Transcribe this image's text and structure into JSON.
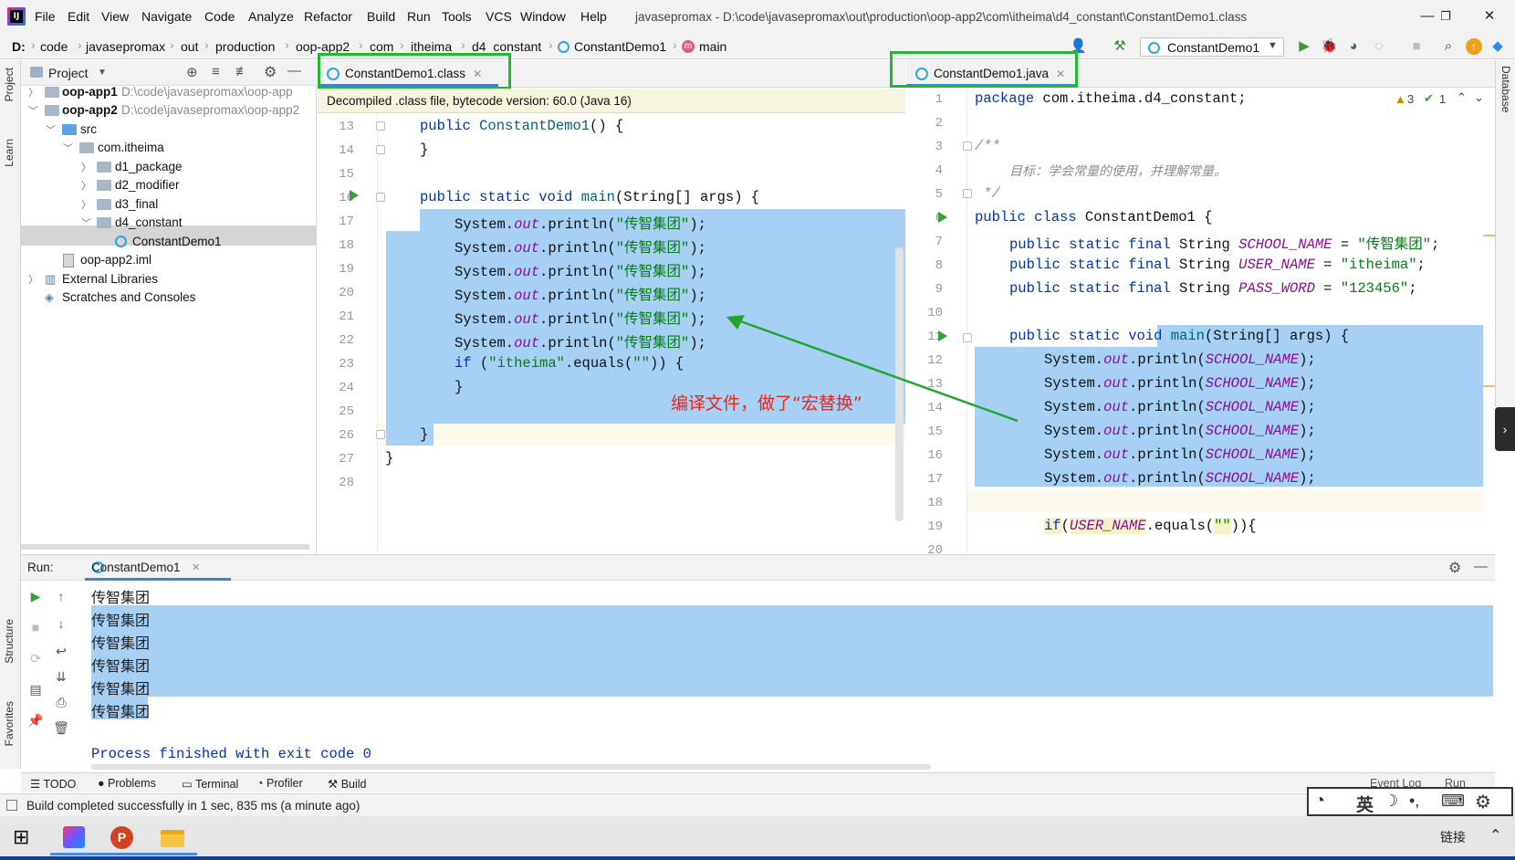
{
  "menu": {
    "items": [
      "File",
      "Edit",
      "View",
      "Navigate",
      "Code",
      "Analyze",
      "Refactor",
      "Build",
      "Run",
      "Tools",
      "VCS",
      "Window",
      "Help"
    ],
    "window_title": "javasepromax - D:\\code\\javasepromax\\out\\production\\oop-app2\\com\\itheima\\d4_constant\\ConstantDemo1.class"
  },
  "breadcrumb": [
    "D:",
    "code",
    "javasepromax",
    "out",
    "production",
    "oop-app2",
    "com",
    "itheima",
    "d4_constant",
    "ConstantDemo1",
    "main"
  ],
  "run_config": "ConstantDemo1",
  "left_stripe": [
    "Project",
    "Learn",
    "Structure",
    "Favorites"
  ],
  "right_stripe": [
    "Database"
  ],
  "project": {
    "title": "Project",
    "tree": [
      {
        "label": "oop-app1",
        "hint": "D:\\code\\javasepromax\\oop-app",
        "bold": true
      },
      {
        "label": "oop-app2",
        "hint": "D:\\code\\javasepromax\\oop-app2",
        "bold": true
      },
      {
        "label": "src"
      },
      {
        "label": "com.itheima"
      },
      {
        "label": "d1_package"
      },
      {
        "label": "d2_modifier"
      },
      {
        "label": "d3_final"
      },
      {
        "label": "d4_constant"
      },
      {
        "label": "ConstantDemo1"
      },
      {
        "label": "oop-app2.iml"
      },
      {
        "label": "External Libraries"
      },
      {
        "label": "Scratches and Consoles"
      }
    ]
  },
  "left_editor": {
    "tab": "ConstantDemo1.class",
    "banner": "Decompiled .class file, bytecode version: 60.0 (Java 16)",
    "line_numbers": [
      "13",
      "14",
      "15",
      "16",
      "17",
      "18",
      "19",
      "20",
      "21",
      "22",
      "23",
      "24",
      "25",
      "26",
      "27",
      "28"
    ]
  },
  "right_editor": {
    "tab": "ConstantDemo1.java",
    "line_numbers": [
      "1",
      "2",
      "3",
      "4",
      "5",
      "6",
      "7",
      "8",
      "9",
      "10",
      "11",
      "12",
      "13",
      "14",
      "15",
      "16",
      "17",
      "18",
      "19",
      "20"
    ],
    "comment_text": "目标：学会常量的使用，并理解常量。",
    "inspections": {
      "warnings": "3",
      "ok": "1"
    }
  },
  "annotation": {
    "text": "编译文件，做了“宏替换”",
    "color": "#e8251e",
    "arrow_color": "#22a52e"
  },
  "run_panel": {
    "label": "Run:",
    "tab": "ConstantDemo1",
    "output": [
      "传智集团",
      "传智集团",
      "传智集团",
      "传智集团",
      "传智集团",
      "传智集团"
    ],
    "exit_message": "Process finished with exit code 0"
  },
  "bottom_tabs": [
    "TODO",
    "Problems",
    "Terminal",
    "Profiler",
    "Build"
  ],
  "bottom_right": [
    "Event Log",
    "Run"
  ],
  "status": "Build completed successfully in 1 sec, 835 ms (a minute ago)",
  "ime": {
    "lang": "英"
  },
  "taskbar": {
    "tray_text": "链接"
  },
  "colors": {
    "selection": "#a7d0f5",
    "highlight_box": "#21b832",
    "keyword": "#0033b3",
    "string": "#067d17",
    "static_field": "#871094"
  }
}
